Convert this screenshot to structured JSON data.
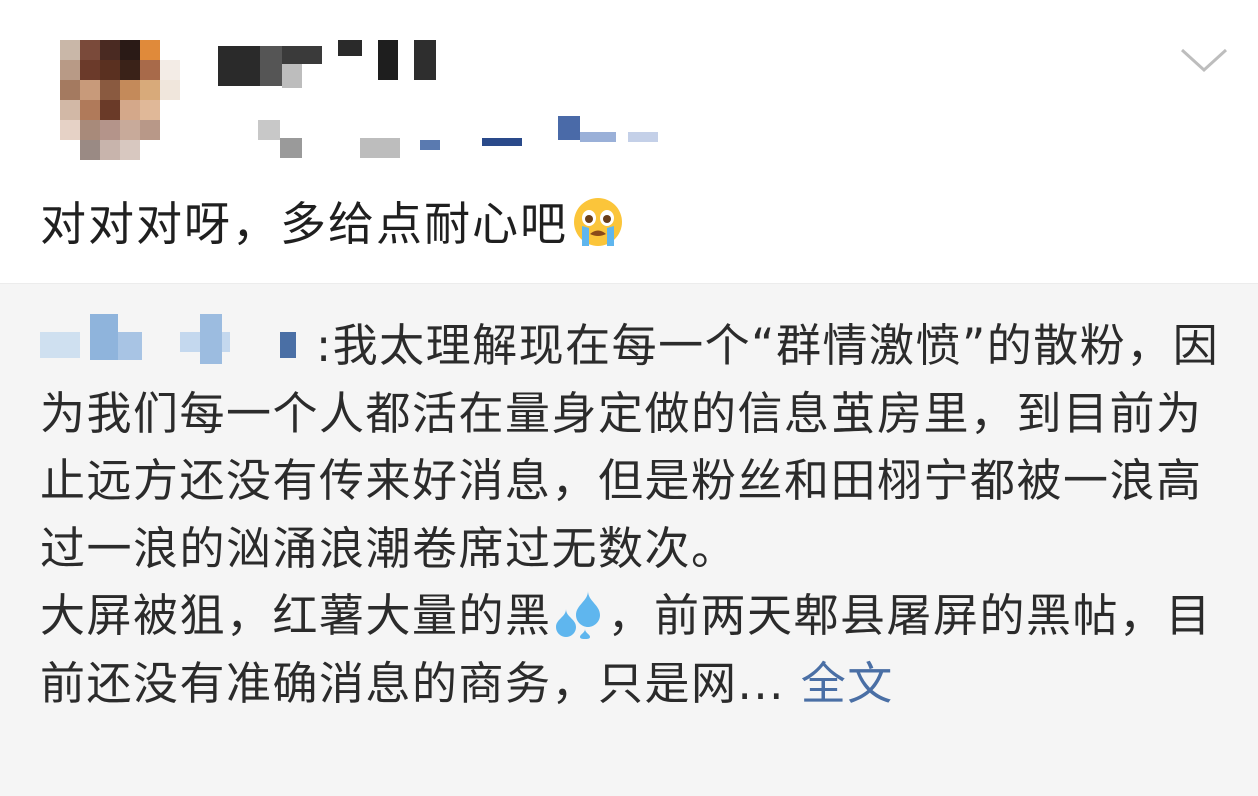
{
  "post": {
    "text": "对对对呀，多给点耐心吧",
    "emoji": "crying-face"
  },
  "repost": {
    "paragraph1": ":我太理解现在每一个“群情激愤”的散粉，因为我们每一个人都活在量身定做的信息茧房里，到目前为止远方还没有传来好消息，但是粉丝和田栩宁都被一浪高过一浪的汹涌浪潮卷席过无数次。",
    "paragraph2_before_icon": "大屏被狙，红薯大量的黑",
    "paragraph2_after_icon": "，前两天郫县屠屏的黑帖，目前还没有准确消息的商务，只是网",
    "ellipsis": "...",
    "more_link": "全文"
  },
  "icons": [
    "chevron-down-icon",
    "crying-face-emoji",
    "sweat-drops-emoji"
  ],
  "colors": {
    "link": "#4a6fa5",
    "repost_bg": "#f5f5f5",
    "text": "#1f1f1f"
  }
}
